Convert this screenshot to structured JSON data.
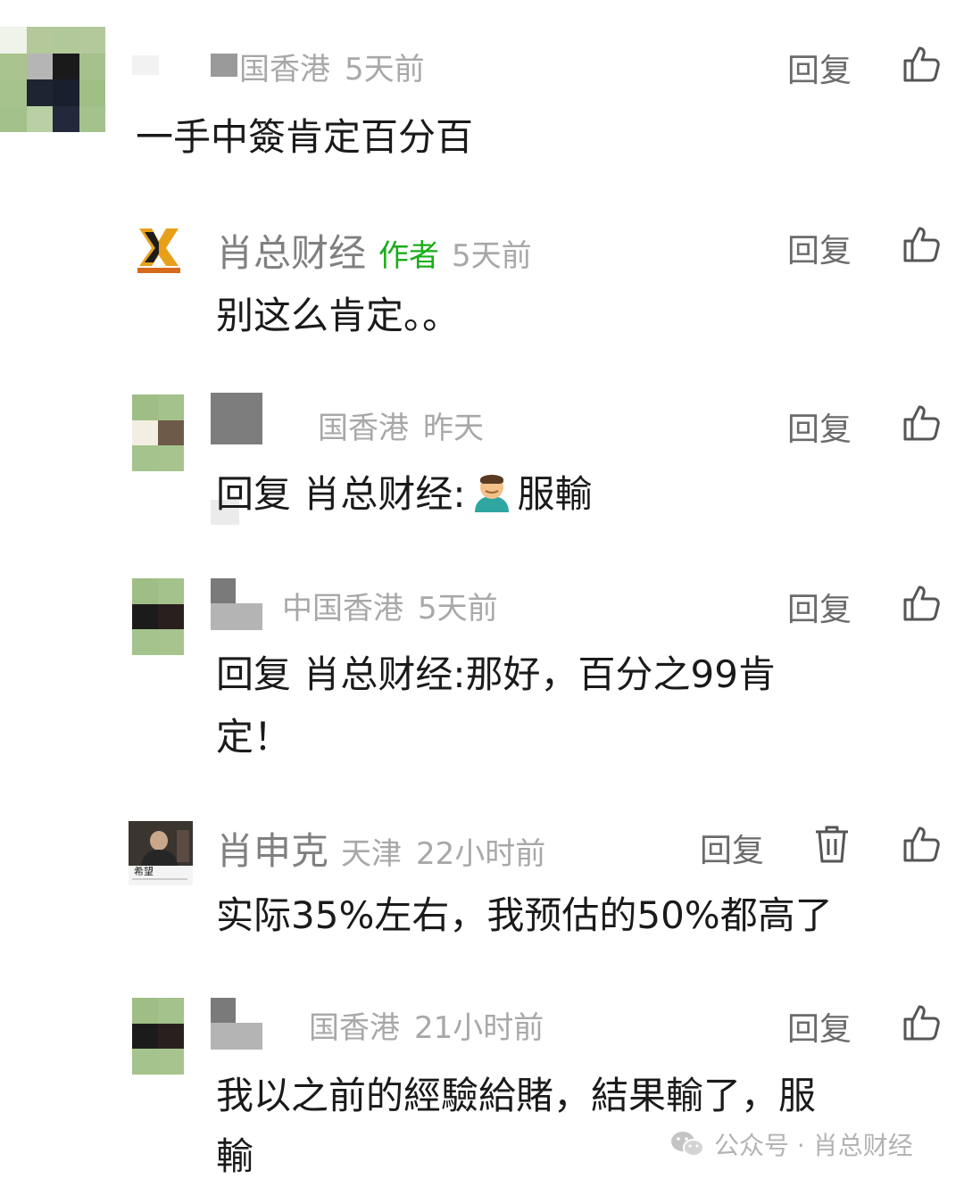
{
  "comments": [
    {
      "name": "",
      "location": "国香港",
      "time": "5天前",
      "reply_label": "回复",
      "text": "一手中簽肯定百分百"
    },
    {
      "name": "肖总财经",
      "author_tag": "作者",
      "time": "5天前",
      "reply_label": "回复",
      "text": "别这么肯定。。"
    },
    {
      "name": "",
      "location": "国香港",
      "time": "昨天",
      "reply_label": "回复",
      "reply_prefix": "回复 肖总财经:",
      "text": "服輸"
    },
    {
      "name": "",
      "location": "中国香港",
      "time": "5天前",
      "reply_label": "回复",
      "reply_prefix": "回复 肖总财经:",
      "text_line1": "那好，百分之99肯",
      "text_line2": "定！"
    },
    {
      "name": "肖申克",
      "location": "天津",
      "time": "22小时前",
      "reply_label": "回复",
      "avatar_caption": "希望",
      "text": "实际35%左右，我预估的50%都高了"
    },
    {
      "name": "",
      "location": "国香港",
      "time": "21小时前",
      "reply_label": "回复",
      "text_line1": "我以之前的經驗給賭，結果輸了，服",
      "text_line2": "輸"
    }
  ],
  "watermark": "公众号 · 肖总财经",
  "icons": {
    "like": "thumbs-up-icon",
    "delete": "trash-icon",
    "watermark_logo": "wechat-icon",
    "emoji": "man-bowing-emoji"
  },
  "colors": {
    "author_tag": "#1aad19",
    "meta": "#a8a8a8",
    "name": "#808080",
    "text": "#1a1a1a"
  }
}
